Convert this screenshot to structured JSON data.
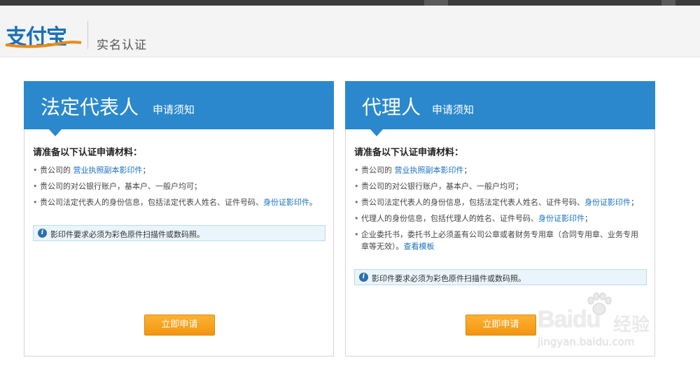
{
  "header": {
    "logo_text": "支付宝",
    "title": "实名认证"
  },
  "panels": [
    {
      "title": "法定代表人",
      "subtitle": "申请须知",
      "heading": "请准备以下认证申请材料：",
      "items": [
        {
          "pre": "贵公司的 ",
          "link": "营业执照副本影印件",
          "post": "；"
        },
        {
          "pre": "贵公司的对公银行账户，基本户、一般户均可；",
          "link": "",
          "post": ""
        },
        {
          "pre": "贵公司法定代表人的身份信息，包括法定代表人姓名、证件号码、",
          "link": "身份证影印件",
          "post": "。"
        }
      ],
      "notice": "影印件要求必须为彩色原件扫描件或数码照。",
      "button": "立即申请"
    },
    {
      "title": "代理人",
      "subtitle": "申请须知",
      "heading": "请准备以下认证申请材料：",
      "items": [
        {
          "pre": "贵公司的 ",
          "link": "营业执照副本影印件",
          "post": "；"
        },
        {
          "pre": "贵公司的对公银行账户，基本户、一般户均可；",
          "link": "",
          "post": ""
        },
        {
          "pre": "贵公司法定代表人的身份信息，包括法定代表人姓名、证件号码、",
          "link": "身份证影印件",
          "post": "；"
        },
        {
          "pre": "代理人的身份信息，包括代理人的姓名、证件号码、",
          "link": "身份证影印件",
          "post": "；"
        },
        {
          "pre": "企业委托书，委托书上必须盖有公司公章或者财务专用章（合同专用章、业务专用章等无效）。",
          "link": "查看模板",
          "post": ""
        }
      ],
      "notice": "影印件要求必须为彩色原件扫描件或数码照。",
      "button": "立即申请"
    }
  ],
  "watermark": {
    "brand": "Baidu",
    "brand_cn": "经验",
    "url": "jingyan.baidu.com"
  },
  "colors": {
    "panel_header": "#2b88cc",
    "link": "#1a73c0",
    "button": "#f29611",
    "notice_bg": "#eaf5fb"
  }
}
